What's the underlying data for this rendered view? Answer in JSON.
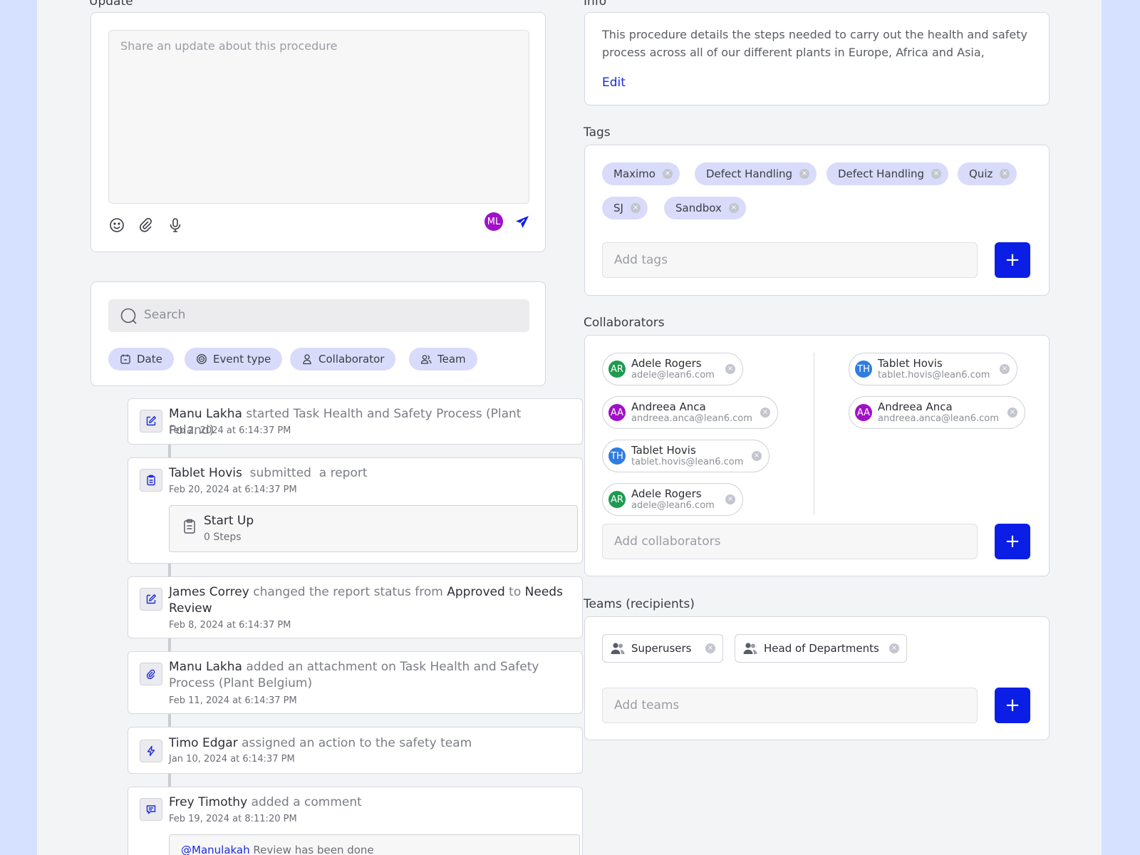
{
  "update": {
    "label": "Update",
    "placeholder": "Share an update about this procedure",
    "avatar_initials": "ML",
    "avatar_color": "#a010c8"
  },
  "search": {
    "placeholder": "Search",
    "filters": [
      {
        "label": "Date",
        "icon": "calendar-icon"
      },
      {
        "label": "Event type",
        "icon": "event-type-icon"
      },
      {
        "label": "Collaborator",
        "icon": "user-icon"
      },
      {
        "label": "Team",
        "icon": "users-icon"
      }
    ]
  },
  "events": [
    {
      "actor": "Manu Lakha",
      "action": " started Task Health and Safety Process (Plant Poland)",
      "date": "Feb 2, 2024 at 6:14:37 PM",
      "icon": "edit-icon"
    },
    {
      "actor": "Tablet Hovis",
      "action": "  submitted  a report",
      "date": "Feb 20, 2024 at 6:14:37 PM",
      "icon": "clipboard-icon",
      "attachment_title": "Start Up",
      "attachment_sub": "0 Steps"
    },
    {
      "actor": "James Correy",
      "action1": " changed the report status from ",
      "from": "Approved",
      "action2": " to ",
      "to": "Needs Review",
      "date": "Feb 8, 2024 at 6:14:37 PM",
      "icon": "edit-icon"
    },
    {
      "actor": "Manu Lakha",
      "action": " added an attachment on Task Health and Safety Process (Plant Belgium)",
      "date": "Feb 11, 2024 at 6:14:37 PM",
      "icon": "paperclip-icon"
    },
    {
      "actor": "Timo Edgar",
      "action": " assigned an action to the safety team",
      "date": "Jan 10, 2024 at 6:14:37 PM",
      "icon": "lightning-icon"
    },
    {
      "actor": "Frey Timothy",
      "action": " added a comment",
      "date": "Feb 19, 2024 at 8:11:20 PM",
      "icon": "comment-icon",
      "mention": "@Manulakah",
      "comment": " Review has been done"
    }
  ],
  "info": {
    "label": "Info",
    "text": "This procedure details the steps needed to carry out the health and  safety process across all of our different plants in Europe, Africa and Asia,",
    "edit_label": "Edit"
  },
  "tags": {
    "label": "Tags",
    "items": [
      "Maximo",
      "Defect Handling",
      "Defect Handling",
      "Quiz",
      "SJ",
      "Sandbox"
    ],
    "add_placeholder": "Add tags"
  },
  "collaborators": {
    "label": "Collaborators",
    "left": [
      {
        "initials": "AR",
        "name": "Adele Rogers",
        "email": "adele@lean6.com",
        "color": "#1f9a4f"
      },
      {
        "initials": "AA",
        "name": "Andreea Anca",
        "email": "andreea.anca@lean6.com",
        "color": "#a010c8"
      },
      {
        "initials": "TH",
        "name": "Tablet Hovis",
        "email": "tablet.hovis@lean6.com",
        "color": "#2f7de0"
      },
      {
        "initials": "AR",
        "name": "Adele Rogers",
        "email": "adele@lean6.com",
        "color": "#1f9a4f"
      }
    ],
    "right": [
      {
        "initials": "TH",
        "name": "Tablet Hovis",
        "email": "tablet.hovis@lean6.com",
        "color": "#2f7de0"
      },
      {
        "initials": "AA",
        "name": "Andreea Anca",
        "email": "andreea.anca@lean6.com",
        "color": "#a010c8"
      }
    ],
    "add_placeholder": "Add collaborators"
  },
  "teams": {
    "label": "Teams (recipients)",
    "items": [
      "Superusers",
      "Head of Departments"
    ],
    "add_placeholder": "Add teams"
  },
  "add_button_symbol": "+",
  "remove_symbol": "×",
  "accent_color": "#0a1ee6"
}
